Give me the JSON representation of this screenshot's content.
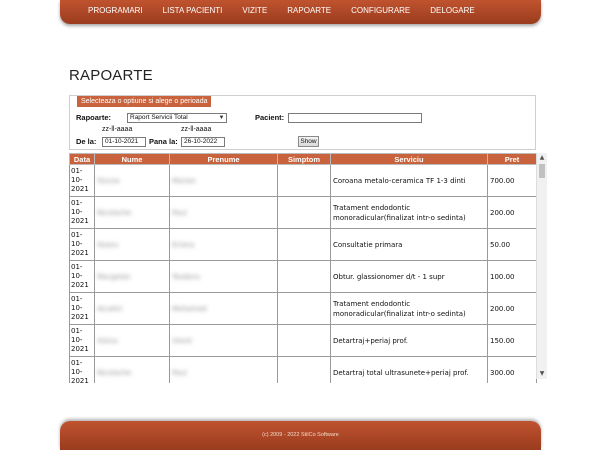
{
  "nav": {
    "items": [
      "PROGRAMARI",
      "LISTA PACIENTI",
      "VIZITE",
      "RAPOARTE",
      "CONFIGURARE",
      "DELOGARE"
    ]
  },
  "page": {
    "title": "RAPOARTE"
  },
  "filter": {
    "header": "Selecteaza o optiune si alege o perioada",
    "rapoarte_label": "Rapoarte:",
    "rapoarte_value": "Raport Servicii Total",
    "pacient_label": "Pacient:",
    "pacient_value": "",
    "format_hint_from": "zz-ll-aaaa",
    "format_hint_to": "zz-ll-aaaa",
    "from_label": "De la:",
    "from_value": "01-10-2021",
    "to_label": "Pana la:",
    "to_value": "26-10-2022",
    "show_button": "Show"
  },
  "table": {
    "headers": [
      "Data",
      "Nume",
      "Prenume",
      "Simptom",
      "Serviciu",
      "Pret"
    ],
    "rows": [
      {
        "date_a": "01-",
        "date_b": "10-",
        "date_c": "2021",
        "nume": "Sturza",
        "prenume": "Marian",
        "simptom": "",
        "serviciu": "Coroana metalo-ceramica TF 1-3 dinti",
        "pret": "700.00"
      },
      {
        "date_a": "01-",
        "date_b": "10-",
        "date_c": "2021",
        "nume": "Nicolache",
        "prenume": "Paul",
        "simptom": "",
        "serviciu": "Tratament endodontic monoradicular(finalizat intr-o sedinta)",
        "pret": "200.00"
      },
      {
        "date_a": "01-",
        "date_b": "10-",
        "date_c": "2021",
        "nume": "Ileanu",
        "prenume": "Eriana",
        "simptom": "",
        "serviciu": "Consultatie primara",
        "pret": "50.00"
      },
      {
        "date_a": "01-",
        "date_b": "10-",
        "date_c": "2021",
        "nume": "Macgelan",
        "prenume": "Teodora",
        "simptom": "",
        "serviciu": "Obtur. glassionomer d/t - 1 supr",
        "pret": "100.00"
      },
      {
        "date_a": "01-",
        "date_b": "10-",
        "date_c": "2021",
        "nume": "Alcalini",
        "prenume": "Mohamed",
        "simptom": "",
        "serviciu": "Tratament endodontic monoradicular(finalizat intr-o sedinta)",
        "pret": "200.00"
      },
      {
        "date_a": "01-",
        "date_b": "10-",
        "date_c": "2021",
        "nume": "Viziva",
        "prenume": "Viorel",
        "simptom": "",
        "serviciu": "Detartraj+periaj prof.",
        "pret": "150.00"
      },
      {
        "date_a": "01-",
        "date_b": "10-",
        "date_c": "2021",
        "nume": "Nicolache",
        "prenume": "Paul",
        "simptom": "",
        "serviciu": "Detartraj total ultrasunete+periaj prof.",
        "pret": "300.00"
      }
    ]
  },
  "footer": {
    "text": "(c) 2009 - 2022 StilCo Software"
  },
  "colors": {
    "brand": "#b04a26",
    "header_bg": "#c9633e"
  }
}
